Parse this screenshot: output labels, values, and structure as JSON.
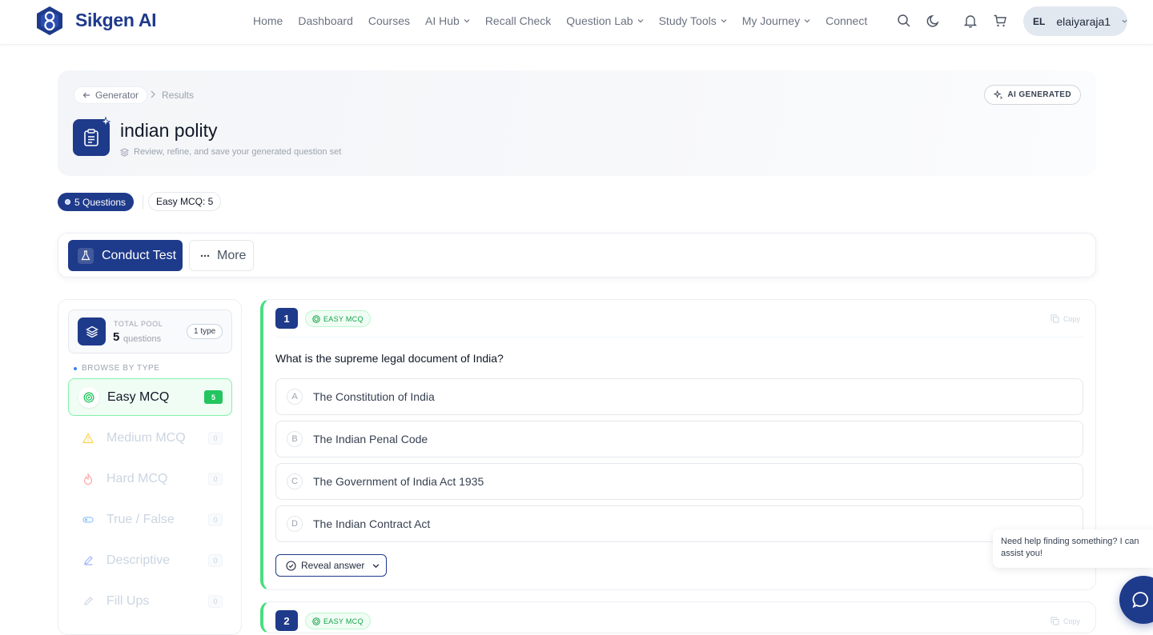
{
  "brand": {
    "name": "Sikgen AI"
  },
  "nav": {
    "items": [
      {
        "label": "Home",
        "dropdown": false
      },
      {
        "label": "Dashboard",
        "dropdown": false
      },
      {
        "label": "Courses",
        "dropdown": false
      },
      {
        "label": "AI Hub",
        "dropdown": true
      },
      {
        "label": "Recall Check",
        "dropdown": false
      },
      {
        "label": "Question Lab",
        "dropdown": true
      },
      {
        "label": "Study Tools",
        "dropdown": true
      },
      {
        "label": "My Journey",
        "dropdown": true
      },
      {
        "label": "Connect",
        "dropdown": false
      }
    ],
    "icons": [
      "search-icon",
      "moon-icon",
      "bell-icon",
      "cart-icon"
    ],
    "user": {
      "initials": "EL",
      "name": "elaiyaraja1"
    }
  },
  "header": {
    "back_label": "Generator",
    "crumb_current": "Results",
    "badge": "AI GENERATED",
    "title": "indian polity",
    "subtitle": "Review, refine, and save your generated question set"
  },
  "stats": {
    "questions_chip": "5 Questions",
    "type_chip": "Easy MCQ: 5"
  },
  "toolbar": {
    "conduct_label": "Conduct Test",
    "more_label": "More"
  },
  "sidebar": {
    "pool_label": "TOTAL POOL",
    "pool_count": "5",
    "pool_unit": "questions",
    "pool_types": "1 type",
    "browse_label": "BROWSE BY TYPE",
    "types": [
      {
        "name": "Easy MCQ",
        "count": "5",
        "icon": "target-icon",
        "active": true
      },
      {
        "name": "Medium MCQ",
        "count": "0",
        "icon": "warning-icon",
        "active": false
      },
      {
        "name": "Hard MCQ",
        "count": "0",
        "icon": "flame-icon",
        "active": false
      },
      {
        "name": "True / False",
        "count": "0",
        "icon": "toggle-icon",
        "active": false
      },
      {
        "name": "Descriptive",
        "count": "0",
        "icon": "pen-icon",
        "active": false
      },
      {
        "name": "Fill Ups",
        "count": "0",
        "icon": "pencil-icon",
        "active": false
      }
    ]
  },
  "question": {
    "number": "1",
    "type_label": "EASY MCQ",
    "copy_label": "Copy",
    "text": "What is the supreme legal document of India?",
    "options": [
      {
        "letter": "A",
        "text": "The Constitution of India"
      },
      {
        "letter": "B",
        "text": "The Indian Penal Code"
      },
      {
        "letter": "C",
        "text": "The Government of India Act 1935"
      },
      {
        "letter": "D",
        "text": "The Indian Contract Act"
      }
    ],
    "reveal_label": "Reveal answer"
  },
  "question2": {
    "number": "2",
    "type_label": "EASY MCQ",
    "copy_label": "Copy"
  },
  "help": {
    "text": "Need help finding something? I can assist you!"
  },
  "colors": {
    "primary": "#1e3a8a",
    "success": "#22c55e",
    "accent_border": "#4ade80"
  }
}
